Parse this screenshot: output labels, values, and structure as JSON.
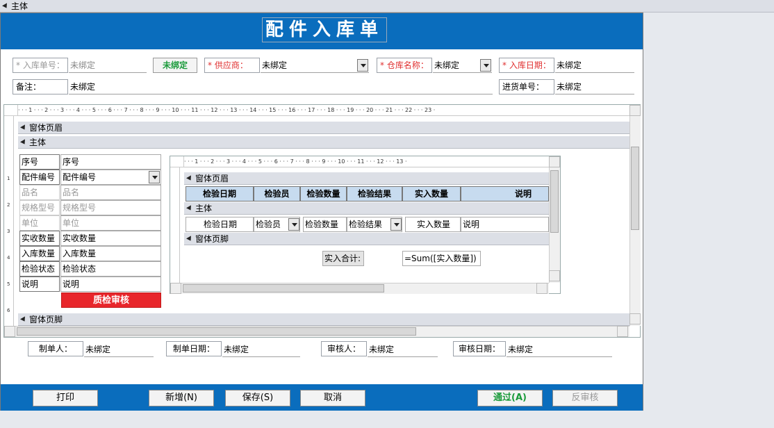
{
  "topbar": {
    "section": "主体"
  },
  "title": "配件入库单",
  "fields": {
    "order_no_label": "* 入库单号：",
    "order_no_value": "未绑定",
    "unbound_button": "未绑定",
    "supplier_label": "* 供应商：",
    "supplier_value": "未绑定",
    "warehouse_label": "* 仓库名称：",
    "warehouse_value": "未绑定",
    "date_label": "* 入库日期：",
    "date_value": "未绑定",
    "remark_label": "备注：",
    "remark_value": "未绑定",
    "purchase_no_label": "进货单号：",
    "purchase_no_value": "未绑定"
  },
  "design": {
    "ruler_text": "· · · 1 · · · 2 · · · 3 · · · 4 · · · 5 · · · 6 · · · 7 · · · 8 · · · 9 · · · 10 · · · 11 · · · 12 · · · 13 · · · 14 · · · 15 · · · 16 · · · 17 · · · 18 · · · 19 · · · 20 · · · 21 · · · 22 · · · 23 ·",
    "form_header": "窗体页眉",
    "body": "主体",
    "form_footer": "窗体页脚",
    "left_fields": [
      {
        "label": "序号",
        "value": "序号",
        "gray": false,
        "combo": false
      },
      {
        "label": "配件编号",
        "value": "配件编号",
        "gray": false,
        "combo": true
      },
      {
        "label": "品名",
        "value": "品名",
        "gray": true,
        "combo": false
      },
      {
        "label": "规格型号",
        "value": "规格型号",
        "gray": true,
        "combo": false
      },
      {
        "label": "单位",
        "value": "单位",
        "gray": true,
        "combo": false
      },
      {
        "label": "实收数量",
        "value": "实收数量",
        "gray": false,
        "combo": false
      },
      {
        "label": "入库数量",
        "value": "入库数量",
        "gray": false,
        "combo": false
      },
      {
        "label": "检验状态",
        "value": "检验状态",
        "gray": false,
        "combo": false
      },
      {
        "label": "说明",
        "value": "说明",
        "gray": false,
        "combo": false
      }
    ],
    "qc_button": "质检审核",
    "vruler_marks": [
      "1",
      "2",
      "3",
      "4",
      "5",
      "6"
    ]
  },
  "inner": {
    "ruler_text": "· · · 1 · · · 2 · · · 3 · · · 4 · · · 5 · · · 6 · · · 7 · · · 8 · · · 9 · · · 10 · · · 11 · · · 12 · · · 13 ·",
    "form_header": "窗体页眉",
    "body": "主体",
    "form_footer": "窗体页脚",
    "columns": [
      "检验日期",
      "检验员",
      "检验数量",
      "检验结果",
      "实入数量",
      "说明"
    ],
    "row": [
      "检验日期",
      "检验员",
      "检验数量",
      "检验结果",
      "实入数量",
      "说明"
    ],
    "sum_label": "实入合计:",
    "sum_value": "=Sum([实入数量])"
  },
  "signatures": {
    "maker_label": "制单人：",
    "maker_value": "未绑定",
    "make_date_label": "制单日期：",
    "make_date_value": "未绑定",
    "reviewer_label": "审核人：",
    "reviewer_value": "未绑定",
    "review_date_label": "审核日期：",
    "review_date_value": "未绑定"
  },
  "buttons": {
    "print": "打印",
    "new": "新增(N)",
    "save": "保存(S)",
    "cancel": "取消",
    "approve": "通过(A)",
    "unapprove": "反审核"
  },
  "colors": {
    "brand_blue": "#0a6dbd",
    "required_red": "#e03030",
    "approve_green": "#1a9a3a",
    "qc_red": "#e8262b"
  }
}
